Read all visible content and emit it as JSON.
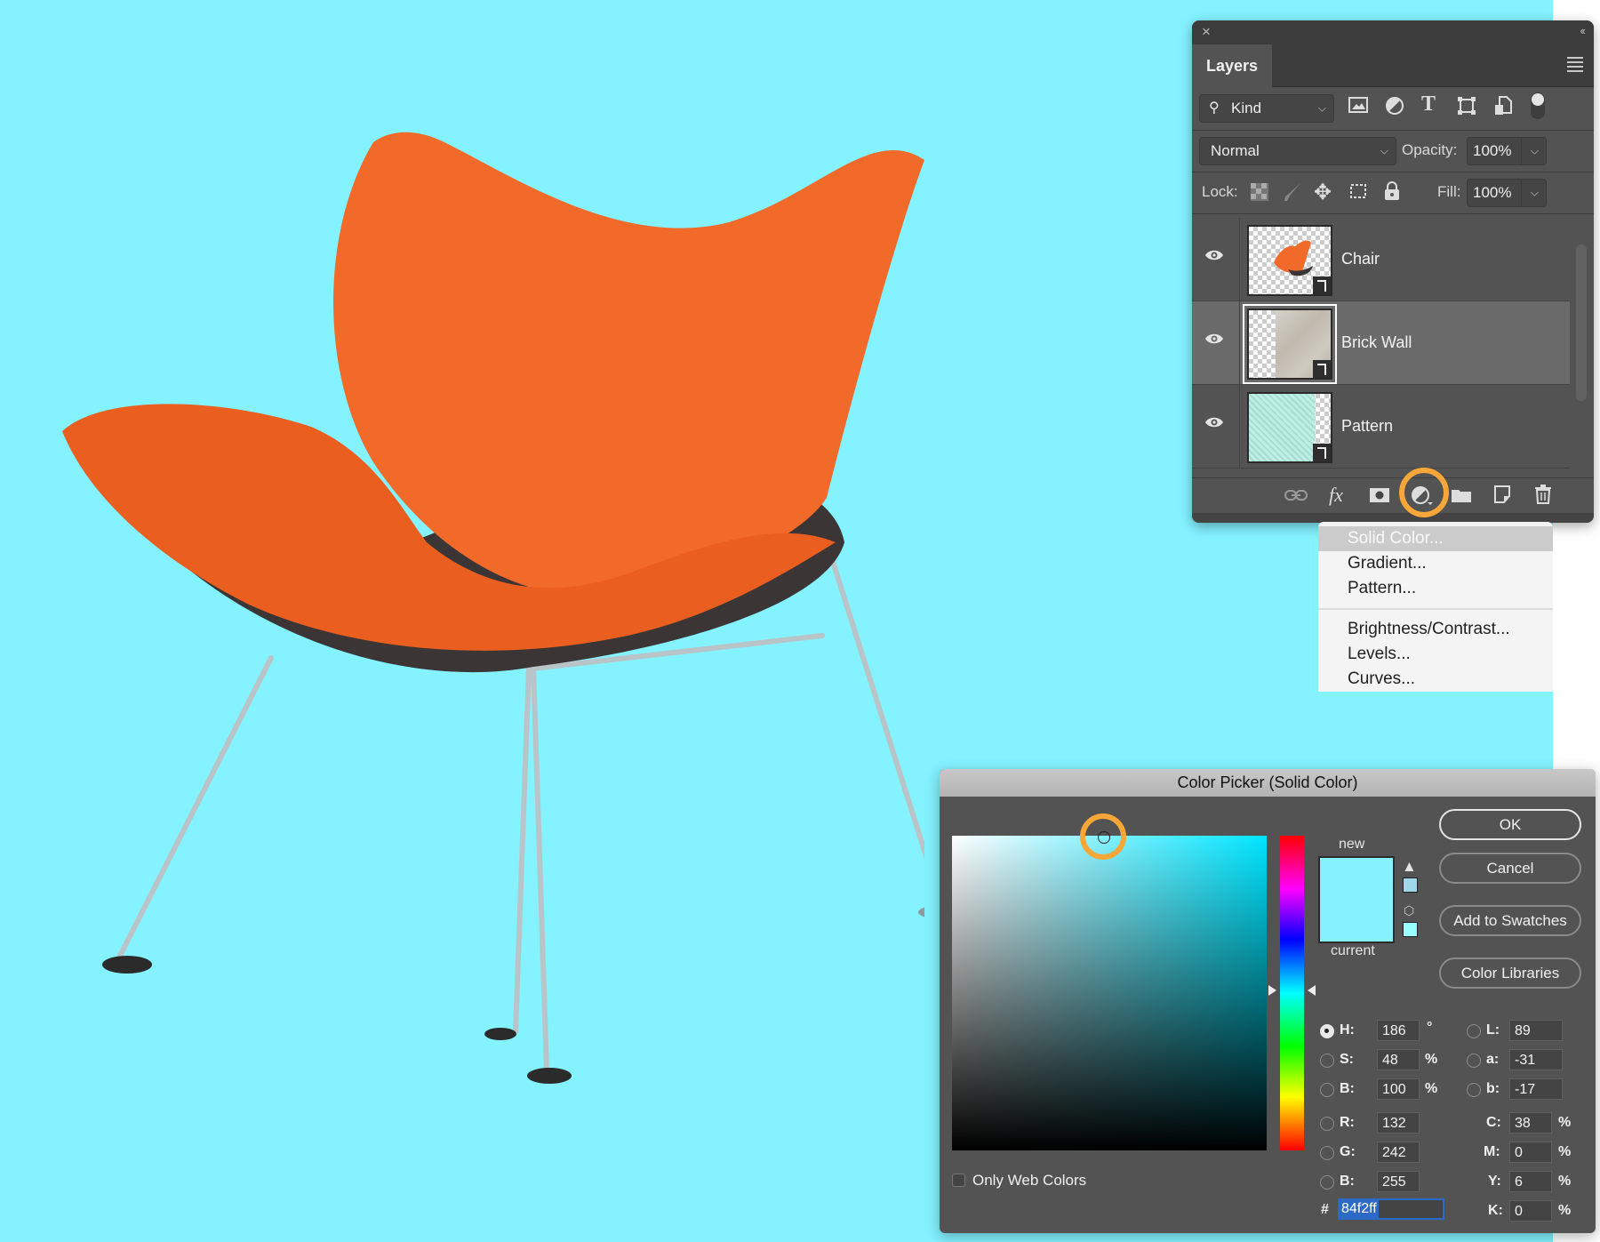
{
  "canvas": {
    "background_color": "#84f2ff",
    "subject": "orange chair"
  },
  "layers_panel": {
    "close_icon": "×",
    "collapse_icon": "‹‹",
    "tab_label": "Layers",
    "filter": {
      "label": "Kind",
      "icons": [
        "image-filter",
        "adjustment-filter",
        "type-filter",
        "shape-filter",
        "smart-object-filter",
        "filter-toggle"
      ]
    },
    "blend_mode": "Normal",
    "opacity_label": "Opacity:",
    "opacity_value": "100%",
    "lock_label": "Lock:",
    "fill_label": "Fill:",
    "fill_value": "100%",
    "layers": [
      {
        "name": "Chair",
        "visible": true,
        "selected": false
      },
      {
        "name": "Brick Wall",
        "visible": true,
        "selected": true
      },
      {
        "name": "Pattern",
        "visible": true,
        "selected": false
      }
    ],
    "footer_icons": [
      "link-layers",
      "fx",
      "add-mask",
      "new-fill-adjustment-layer",
      "new-group",
      "new-layer",
      "delete-layer"
    ],
    "fx_label": "fx"
  },
  "adjustment_menu": {
    "items": [
      {
        "label": "Solid Color...",
        "highlighted": true
      },
      {
        "label": "Gradient..."
      },
      {
        "label": "Pattern..."
      },
      {
        "label": "Brightness/Contrast..."
      },
      {
        "label": "Levels..."
      },
      {
        "label": "Curves..."
      }
    ]
  },
  "color_picker": {
    "title": "Color Picker (Solid Color)",
    "new_label": "new",
    "current_label": "current",
    "new_color": "#84f2ff",
    "current_color": "#84f2ff",
    "buttons": {
      "ok": "OK",
      "cancel": "Cancel",
      "add_to_swatches": "Add to Swatches",
      "color_libraries": "Color Libraries"
    },
    "only_web_colors_label": "Only Web Colors",
    "only_web_colors_checked": false,
    "hsb": {
      "H": "186",
      "S": "48",
      "B": "100"
    },
    "lab": {
      "L": "89",
      "a": "-31",
      "b": "-17"
    },
    "rgb": {
      "R": "132",
      "G": "242",
      "B": "255"
    },
    "cmyk": {
      "C": "38",
      "M": "0",
      "Y": "6",
      "K": "0"
    },
    "selected_mode": "H",
    "units": {
      "degree": "°",
      "percent": "%"
    },
    "labels": {
      "H": "H:",
      "S": "S:",
      "Bv": "B:",
      "L": "L:",
      "a": "a:",
      "b": "b:",
      "R": "R:",
      "G": "G:",
      "Bb": "B:",
      "C": "C:",
      "M": "M:",
      "Y": "Y:",
      "K": "K:",
      "hash": "#"
    },
    "hex_value": "84f2ff"
  },
  "highlight_color": "#f7a738"
}
